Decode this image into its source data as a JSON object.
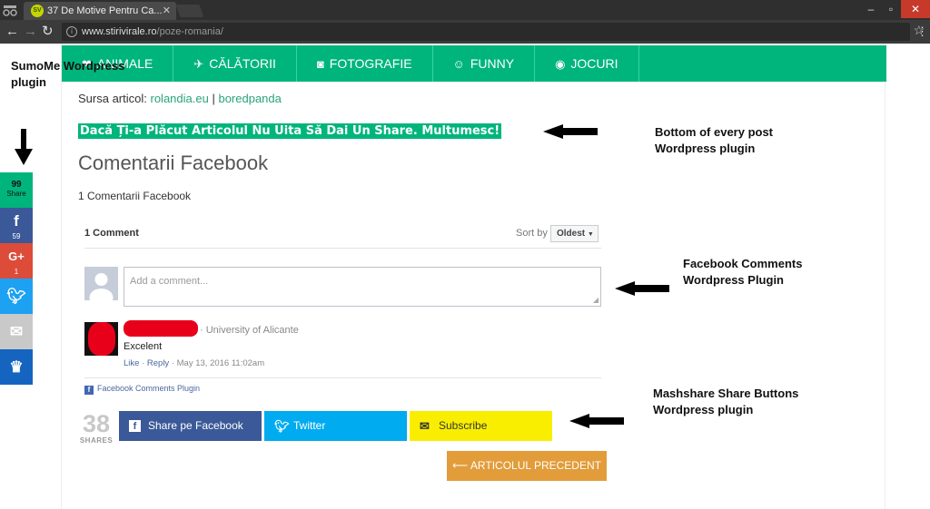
{
  "browser": {
    "tab_title": "37 De Motive Pentru Ca...",
    "tab_favicon_text": "SV",
    "url_host": "www.stirivirale.ro",
    "url_path": "/poze-romania/"
  },
  "site_nav": {
    "items": [
      {
        "label": "ANIMALE",
        "icon": "paw-icon"
      },
      {
        "label": "CĂLĂTORII",
        "icon": "plane-icon"
      },
      {
        "label": "FOTOGRAFIE",
        "icon": "camera-icon"
      },
      {
        "label": "FUNNY",
        "icon": "smiley-icon"
      },
      {
        "label": "JOCURI",
        "icon": "gamepad-icon"
      }
    ]
  },
  "article": {
    "source_label": "Sursa articol:",
    "source_link_1": "rolandia.eu",
    "source_sep": "|",
    "source_link_2": "boredpanda",
    "highlight_text": "Dacă Ți-a Plăcut Articolul Nu Uita Să Dai Un Share. Multumesc!",
    "comments_heading": "Comentarii Facebook",
    "comments_count": "1 Comentarii Facebook"
  },
  "fb_comments": {
    "count_label": "1 Comment",
    "sort_label": "Sort by",
    "sort_value": "Oldest",
    "input_placeholder": "Add a comment...",
    "comment": {
      "affiliation": "· University of Alicante",
      "text": "Excelent",
      "like": "Like",
      "reply": "Reply",
      "date": "· May 13, 2016 11:02am"
    },
    "plugin_label": "Facebook Comments Plugin"
  },
  "mashshare": {
    "share_count": "38",
    "shares_label": "SHARES",
    "facebook_label": "Share pe Facebook",
    "twitter_label": "Twitter",
    "subscribe_label": "Subscribe",
    "prev_label": "⟵ ARTICOLUL PRECEDENT"
  },
  "sumome": {
    "total": "99",
    "total_label": "Share",
    "facebook_count": "59",
    "googleplus_count": "1"
  },
  "annotations": {
    "sumome": "SumoMe Wordpress plugin",
    "bottom_post": "Bottom of every post Wordpress plugin",
    "fb_comments": "Facebook Comments Wordpress Plugin",
    "mashshare": "Mashshare Share Buttons Wordpress plugin"
  },
  "colors": {
    "brand_green": "#00b57c",
    "facebook": "#3b5998",
    "twitter": "#00abf0",
    "subscribe": "#f9ee00",
    "prev_button": "#e29c3a"
  }
}
